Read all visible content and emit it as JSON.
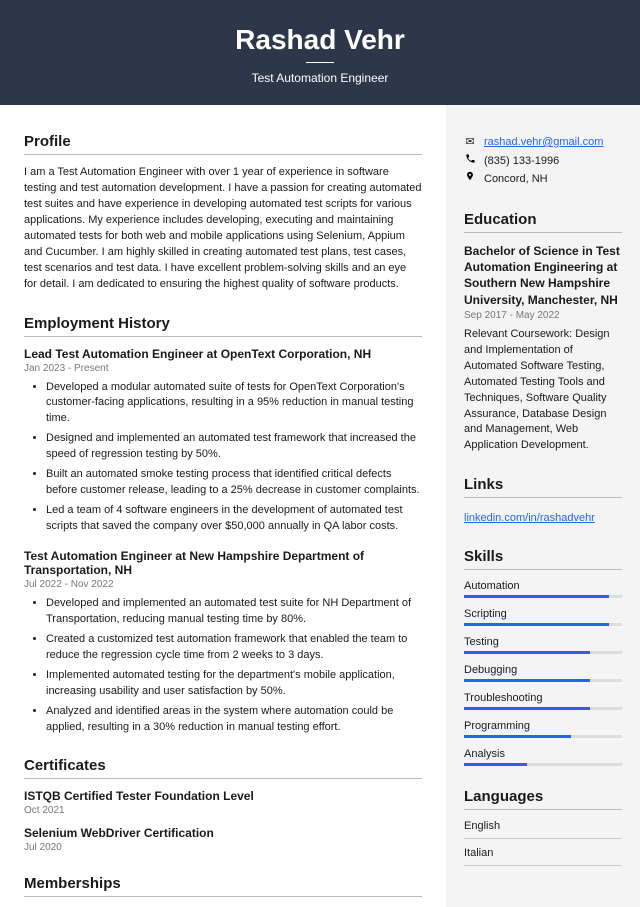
{
  "header": {
    "name": "Rashad Vehr",
    "title": "Test Automation Engineer"
  },
  "profile": {
    "heading": "Profile",
    "text": "I am a Test Automation Engineer with over 1 year of experience in software testing and test automation development. I have a passion for creating automated test suites and have experience in developing automated test scripts for various applications. My experience includes developing, executing and maintaining automated tests for both web and mobile applications using Selenium, Appium and Cucumber. I am highly skilled in creating automated test plans, test cases, test scenarios and test data. I have excellent problem-solving skills and an eye for detail. I am dedicated to ensuring the highest quality of software products."
  },
  "employment": {
    "heading": "Employment History",
    "jobs": [
      {
        "title": "Lead Test Automation Engineer at OpenText Corporation, NH",
        "date": "Jan 2023 - Present",
        "bullets": [
          "Developed a modular automated suite of tests for OpenText Corporation's customer-facing applications, resulting in a 95% reduction in manual testing time.",
          "Designed and implemented an automated test framework that increased the speed of regression testing by 50%.",
          "Built an automated smoke testing process that identified critical defects before customer release, leading to a 25% decrease in customer complaints.",
          "Led a team of 4 software engineers in the development of automated test scripts that saved the company over $50,000 annually in QA labor costs."
        ]
      },
      {
        "title": "Test Automation Engineer at New Hampshire Department of Transportation, NH",
        "date": "Jul 2022 - Nov 2022",
        "bullets": [
          "Developed and implemented an automated test suite for NH Department of Transportation, reducing manual testing time by 80%.",
          "Created a customized test automation framework that enabled the team to reduce the regression cycle time from 2 weeks to 3 days.",
          "Implemented automated testing for the department's mobile application, increasing usability and user satisfaction by 50%.",
          "Analyzed and identified areas in the system where automation could be applied, resulting in a 30% reduction in manual testing effort."
        ]
      }
    ]
  },
  "certificates": {
    "heading": "Certificates",
    "items": [
      {
        "title": "ISTQB Certified Tester Foundation Level",
        "date": "Oct 2021"
      },
      {
        "title": "Selenium WebDriver Certification",
        "date": "Jul 2020"
      }
    ]
  },
  "memberships": {
    "heading": "Memberships"
  },
  "contact": {
    "email": "rashad.vehr@gmail.com",
    "phone": "(835) 133-1996",
    "location": "Concord, NH"
  },
  "education": {
    "heading": "Education",
    "degree": "Bachelor of Science in Test Automation Engineering at Southern New Hampshire University, Manchester, NH",
    "date": "Sep 2017 - May 2022",
    "text": "Relevant Coursework: Design and Implementation of Automated Software Testing, Automated Testing Tools and Techniques, Software Quality Assurance, Database Design and Management, Web Application Development."
  },
  "links": {
    "heading": "Links",
    "url": "linkedin.com/in/rashadvehr"
  },
  "skills": {
    "heading": "Skills",
    "items": [
      {
        "name": "Automation",
        "level": 92
      },
      {
        "name": "Scripting",
        "level": 92
      },
      {
        "name": "Testing",
        "level": 80
      },
      {
        "name": "Debugging",
        "level": 80
      },
      {
        "name": "Troubleshooting",
        "level": 80
      },
      {
        "name": "Programming",
        "level": 68
      },
      {
        "name": "Analysis",
        "level": 40
      }
    ]
  },
  "languages": {
    "heading": "Languages",
    "items": [
      "English",
      "Italian"
    ]
  }
}
